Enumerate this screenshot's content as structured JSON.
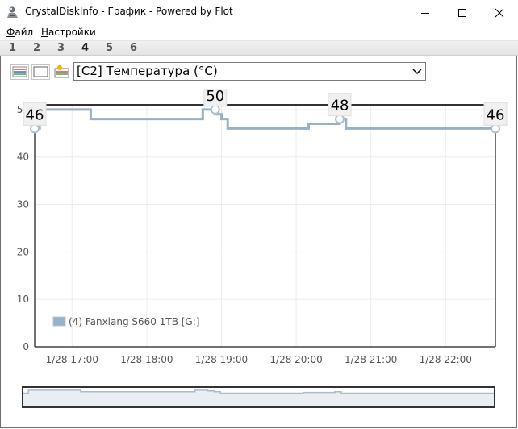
{
  "window": {
    "title": "CrystalDiskInfo - График - Powered by Flot",
    "icons": {
      "app": "crystaldiskinfo-icon",
      "minimize": "minimize-icon",
      "maximize": "maximize-icon",
      "close": "close-icon"
    }
  },
  "menu": {
    "file": {
      "accel": "Ф",
      "rest": "айл"
    },
    "settings": {
      "accel": "Н",
      "rest": "астройки"
    }
  },
  "disk_tabs": [
    "1",
    "2",
    "3",
    "4",
    "5",
    "6"
  ],
  "active_disk_tab": "4",
  "toolbar": {
    "buttons": [
      "colors-icon",
      "blank-icon",
      "legend-icon"
    ],
    "attribute_select": {
      "value": "[C2] Температура (°C)"
    }
  },
  "chart_data": {
    "type": "line",
    "x": [
      "16:30",
      "16:34",
      "16:34",
      "17:15",
      "17:15",
      "18:45",
      "18:45",
      "18:55",
      "18:55",
      "19:00",
      "19:00",
      "19:05",
      "19:05",
      "20:10",
      "20:10",
      "20:20",
      "20:20",
      "20:35",
      "20:35",
      "20:40",
      "20:40",
      "22:40"
    ],
    "x_numeric_hours": [
      16.5,
      16.567,
      16.567,
      17.25,
      17.25,
      18.75,
      18.75,
      18.917,
      18.917,
      19.0,
      19.0,
      19.083,
      19.083,
      20.167,
      20.167,
      20.333,
      20.333,
      20.583,
      20.583,
      20.667,
      20.667,
      22.667
    ],
    "y": [
      46,
      46,
      50,
      50,
      48,
      48,
      50,
      50,
      49,
      49,
      48,
      48,
      46,
      46,
      47,
      47,
      47,
      47,
      48,
      48,
      46,
      46
    ],
    "series": [
      {
        "name": "(4) Fanxiang S660 1TB [G:]",
        "color": "#99b1c5"
      }
    ],
    "x_ticks": [
      "1/28 17:00",
      "1/28 18:00",
      "1/28 19:00",
      "1/28 20:00",
      "1/28 21:00",
      "1/28 22:00"
    ],
    "x_tick_hours": [
      17,
      18,
      19,
      20,
      21,
      22
    ],
    "y_ticks": [
      0,
      10,
      20,
      30,
      40,
      50
    ],
    "ylim": [
      0,
      51
    ],
    "xlim_hours": [
      16.5,
      22.667
    ],
    "grid": true,
    "legend_position": "bottom-left",
    "point_labels": [
      {
        "x_hours": 16.5,
        "y": 46,
        "text": "46"
      },
      {
        "x_hours": 18.917,
        "y": 50,
        "text": "50"
      },
      {
        "x_hours": 20.583,
        "y": 48,
        "text": "48"
      },
      {
        "x_hours": 22.667,
        "y": 46,
        "text": "46"
      }
    ],
    "reference_line_y": 51
  }
}
